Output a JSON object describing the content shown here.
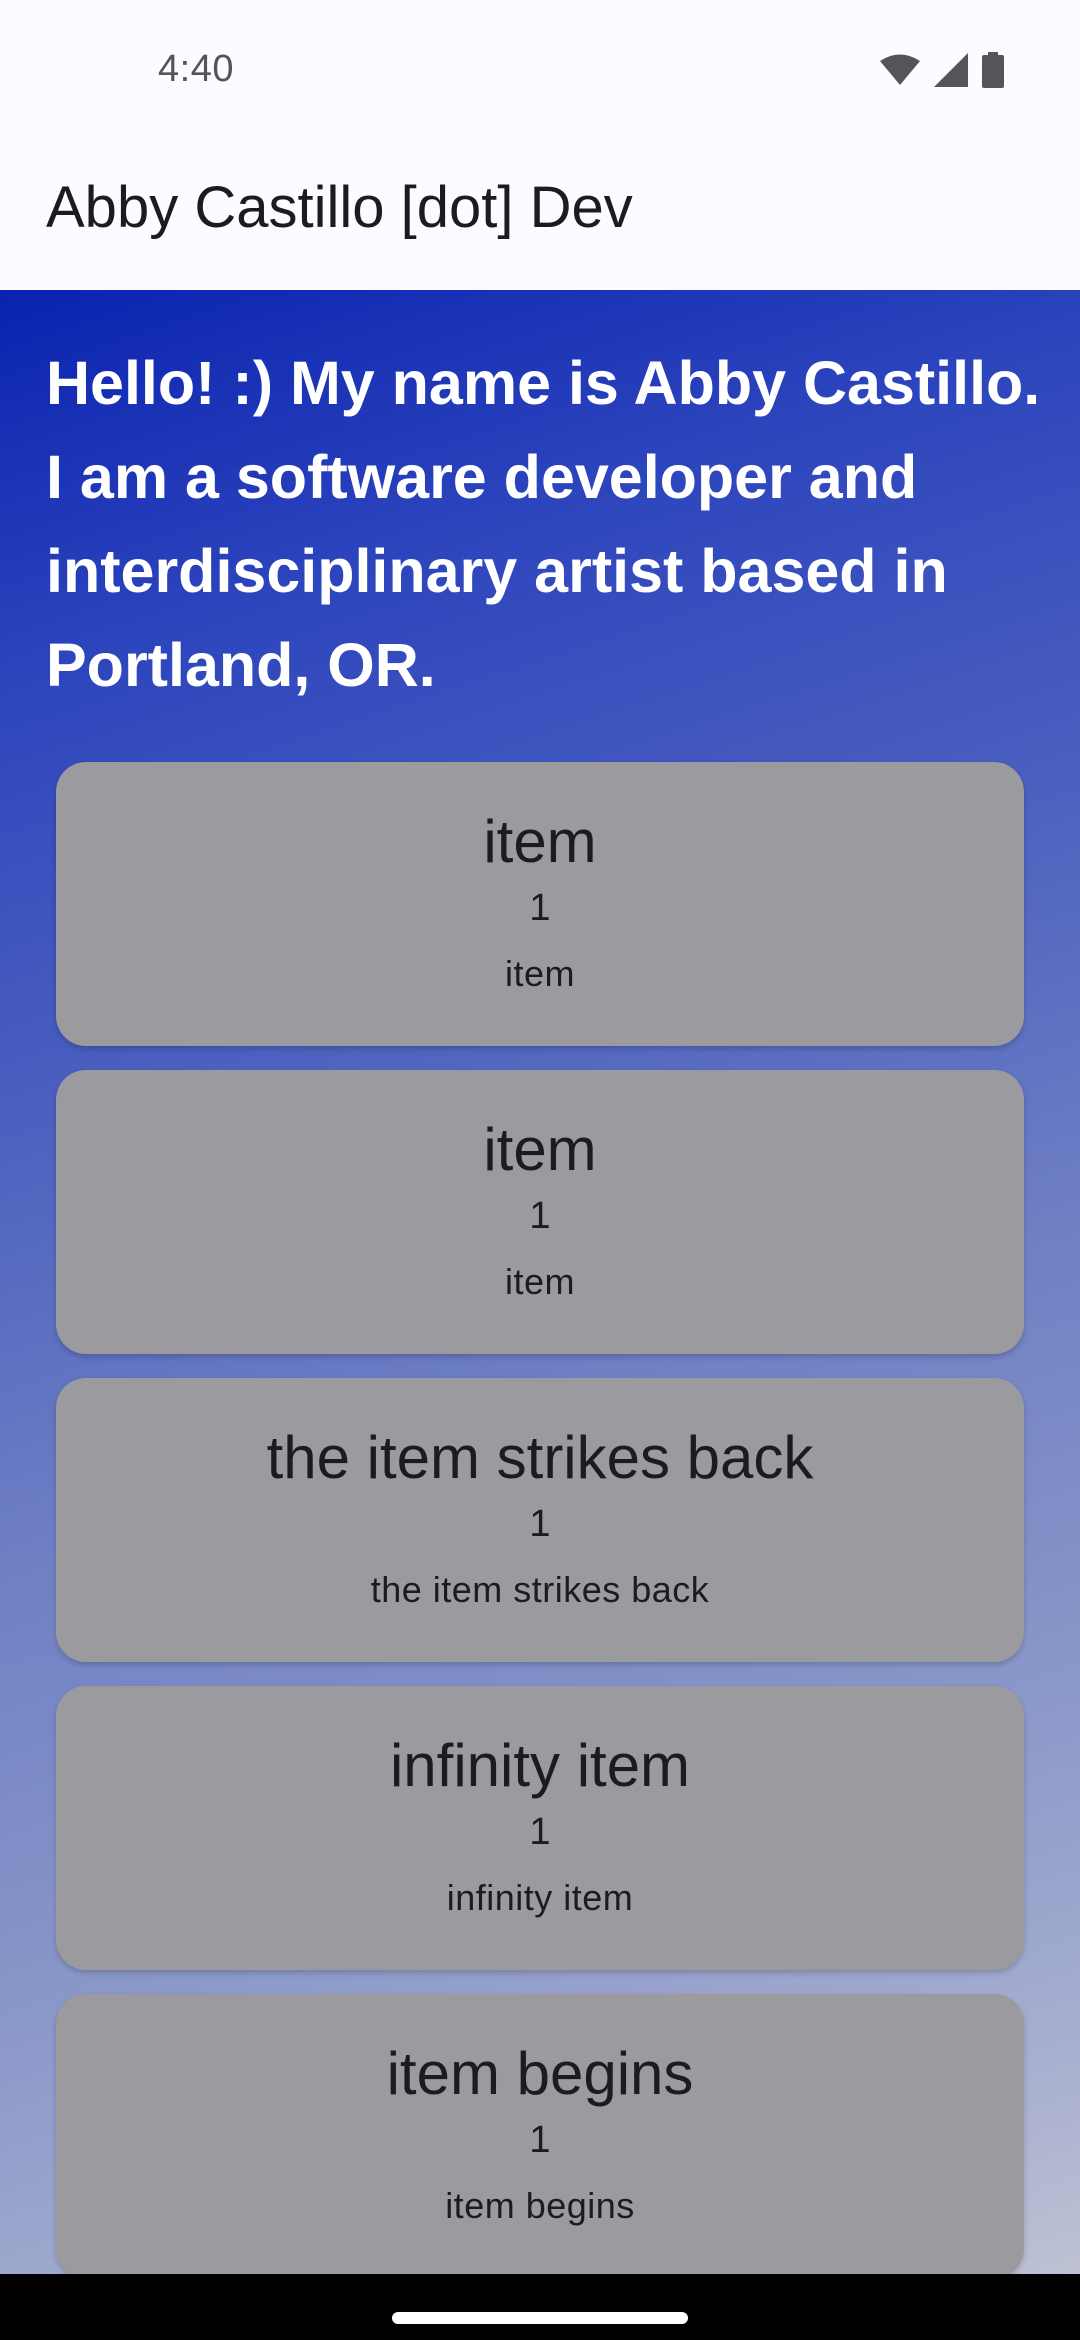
{
  "status_bar": {
    "time": "4:40",
    "icons": [
      "wifi-icon",
      "cellular-signal-icon",
      "battery-icon"
    ]
  },
  "app_bar": {
    "title": "Abby Castillo [dot] Dev"
  },
  "intro": {
    "text": "Hello! :) My name is Abby Castillo. I am a software developer and interdisciplinary artist based in Portland, OR."
  },
  "items": [
    {
      "title": "item",
      "count": "1",
      "subtitle": "item"
    },
    {
      "title": "item",
      "count": "1",
      "subtitle": "item"
    },
    {
      "title": "the item strikes back",
      "count": "1",
      "subtitle": "the item strikes back"
    },
    {
      "title": "infinity item",
      "count": "1",
      "subtitle": "infinity item"
    },
    {
      "title": "item begins",
      "count": "1",
      "subtitle": "item begins"
    }
  ],
  "colors": {
    "gradient_top": "#0a23b0",
    "gradient_bottom": "#bec1d3",
    "card_background": "#9b9a9f",
    "text_primary": "#1d1b20"
  }
}
